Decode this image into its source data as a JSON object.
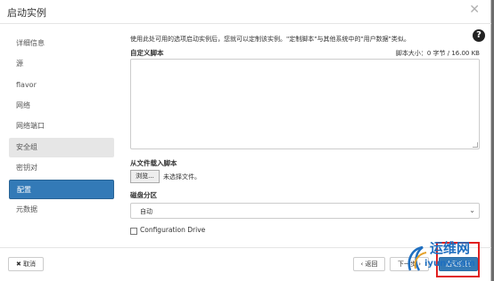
{
  "dialog": {
    "title": "启动实例"
  },
  "sidebar": {
    "items": [
      {
        "label": "详细信息"
      },
      {
        "label": "源"
      },
      {
        "label": "flavor"
      },
      {
        "label": "网络"
      },
      {
        "label": "网络端口"
      },
      {
        "label": "安全组"
      },
      {
        "label": "密钥对"
      },
      {
        "label": "配置"
      },
      {
        "label": "元数据"
      }
    ]
  },
  "main": {
    "description": "使用此处可用的选项启动实例后，您就可以定制该实例。\"定制脚本\"与其他系统中的\"用户数据\"类似。",
    "custom_script_label": "自定义脚本",
    "script_size": "脚本大小：0 字节 / 16.00 KB",
    "load_from_file_label": "从文件载入脚本",
    "browse_label": "浏览...",
    "no_file_label": "未选择文件。",
    "disk_partition_label": "磁盘分区",
    "disk_partition_value": "自动",
    "config_drive_label": "Configuration Drive"
  },
  "footer": {
    "cancel_label": "✖ 取消",
    "back_label": "‹ 返回",
    "next_label": "下一步 ›",
    "launch_label": "启动实例"
  },
  "watermark": {
    "line1": "运维网",
    "line2": "iyunv.com"
  },
  "colors": {
    "accent": "#337ab7",
    "highlight_box": "#e02020"
  },
  "icons": {
    "close": "close-icon",
    "help": "help-icon",
    "dropdown": "chevron-down-icon"
  }
}
